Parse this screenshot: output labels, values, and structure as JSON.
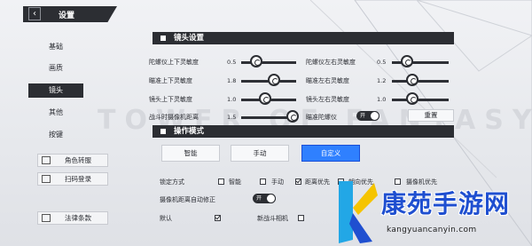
{
  "header": {
    "title": "设置"
  },
  "sidebar": {
    "items": [
      {
        "label": "基础"
      },
      {
        "label": "画质"
      },
      {
        "label": "镜头"
      },
      {
        "label": "其他"
      },
      {
        "label": "按键"
      }
    ],
    "active_index": 2,
    "buttons": [
      {
        "label": "角色转服"
      },
      {
        "label": "扫码登录"
      },
      {
        "label": "法律条款"
      }
    ]
  },
  "background": {
    "watermark": "TOWER OF FANTASY"
  },
  "camera_settings": {
    "title": "镜头设置",
    "gyro_vertical": {
      "label": "陀螺仪上下灵敏度",
      "value": "0.5"
    },
    "gyro_horizontal": {
      "label": "陀螺仪左右灵敏度",
      "value": "0.5"
    },
    "aim_vertical": {
      "label": "瞄准上下灵敏度",
      "value": "1.8"
    },
    "aim_horizontal": {
      "label": "瞄准左右灵敏度",
      "value": "1.2"
    },
    "lens_vertical": {
      "label": "镜头上下灵敏度",
      "value": "1.0"
    },
    "lens_horizontal": {
      "label": "镜头左右灵敏度",
      "value": "1.0"
    },
    "combat_distance": {
      "label": "战斗时摄像机距离",
      "value": "1.5"
    },
    "aim_gyro": {
      "label": "瞄准陀螺仪",
      "state": "开"
    },
    "reset_label": "重置"
  },
  "operation_mode": {
    "title": "操作模式",
    "options": [
      "智能",
      "手动",
      "自定义"
    ],
    "selected": "自定义",
    "lock_mode": {
      "label": "锁定方式",
      "options": [
        {
          "label": "智能",
          "checked": false
        },
        {
          "label": "手动",
          "checked": false
        },
        {
          "label": "距离优先",
          "checked": true
        },
        {
          "label": "朝向优先",
          "checked": false
        },
        {
          "label": "摄像机优先",
          "checked": false
        }
      ]
    },
    "auto_correct": {
      "label": "摄像机距离自动修正",
      "state": "开"
    },
    "defaults": [
      {
        "label": "默认",
        "checked": true
      },
      {
        "label": "新战斗相机",
        "checked": false
      }
    ]
  },
  "brand": {
    "name": "康苑手游网",
    "url": "kangyuancanyin.com"
  },
  "colors": {
    "dark": "#2c2e33",
    "accent": "#2f80ff",
    "brand_blue": "#1f4fd0",
    "brand_yellow": "#f5c400",
    "brand_cyan": "#22a7e6"
  }
}
